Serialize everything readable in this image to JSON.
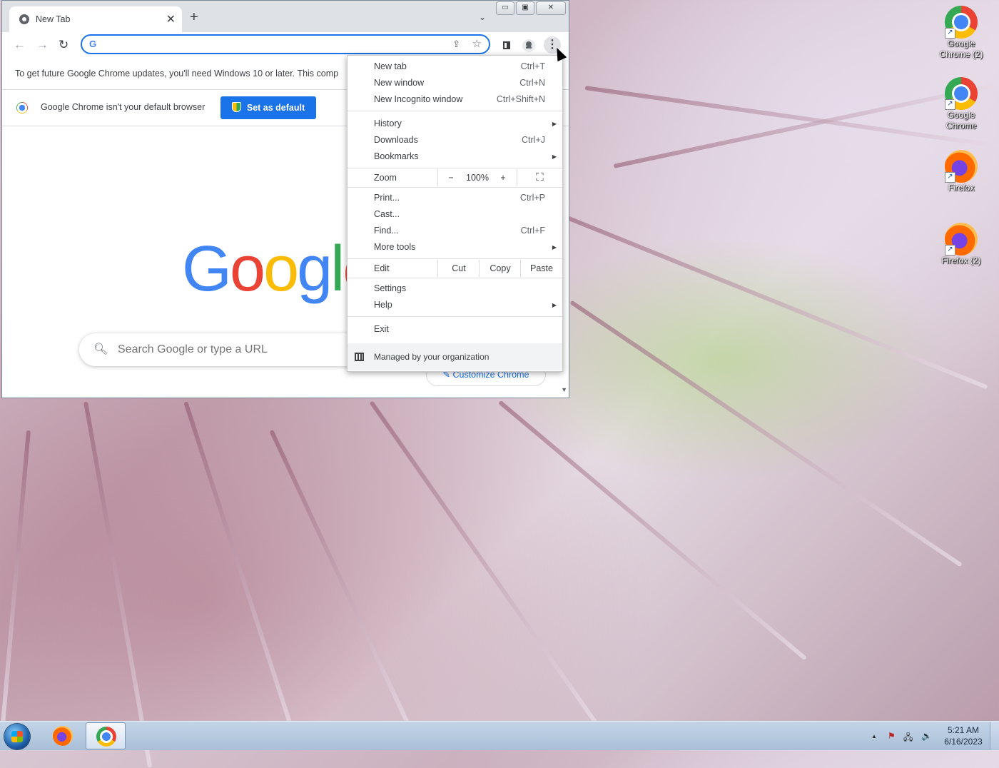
{
  "desktop": {
    "icons": [
      {
        "label_line1": "Google",
        "label_line2": "Chrome (2)",
        "icon": "chrome-icon"
      },
      {
        "label_line1": "Google",
        "label_line2": "Chrome",
        "icon": "chrome-icon"
      },
      {
        "label_line1": "Firefox",
        "label_line2": "",
        "icon": "firefox-icon"
      },
      {
        "label_line1": "Firefox (2)",
        "label_line2": "",
        "icon": "firefox-icon"
      }
    ]
  },
  "browser": {
    "tab": {
      "title": "New Tab",
      "close": "✕"
    },
    "new_tab_symbol": "+",
    "tab_search_symbol": "⌄",
    "window_controls": {
      "minimize": "▭",
      "restore": "▣",
      "close": "✕"
    },
    "toolbar": {
      "back": "←",
      "forward": "→",
      "reload": "↻",
      "omnibox_value": "",
      "omnibox_g": "G",
      "share": "⇪",
      "bookmark": "☆",
      "menu": "⋮"
    },
    "infobar_update": "To get future Google Chrome updates, you'll need Windows 10 or later. This comp",
    "infobar_default": {
      "text": "Google Chrome isn't your default browser",
      "button": "Set as default"
    },
    "ntp": {
      "logo": [
        "G",
        "o",
        "o",
        "g",
        "l",
        "e"
      ],
      "search_placeholder": "Search Google or type a URL",
      "customize": "Customize Chrome",
      "search_icon": "🔍︎",
      "pencil": "✎"
    }
  },
  "menu": {
    "items_top": [
      {
        "label": "New tab",
        "shortcut": "Ctrl+T"
      },
      {
        "label": "New window",
        "shortcut": "Ctrl+N"
      },
      {
        "label": "New Incognito window",
        "shortcut": "Ctrl+Shift+N"
      }
    ],
    "history": {
      "label": "History",
      "arrow": "▶"
    },
    "downloads": {
      "label": "Downloads",
      "shortcut": "Ctrl+J"
    },
    "bookmarks": {
      "label": "Bookmarks",
      "arrow": "▶"
    },
    "zoom": {
      "label": "Zoom",
      "minus": "−",
      "value": "100%",
      "plus": "+",
      "fullscreen": "⛶"
    },
    "print": {
      "label": "Print...",
      "shortcut": "Ctrl+P"
    },
    "cast": {
      "label": "Cast..."
    },
    "find": {
      "label": "Find...",
      "shortcut": "Ctrl+F"
    },
    "more_tools": {
      "label": "More tools",
      "arrow": "▶"
    },
    "edit": {
      "label": "Edit",
      "cut": "Cut",
      "copy": "Copy",
      "paste": "Paste"
    },
    "settings": {
      "label": "Settings"
    },
    "help": {
      "label": "Help",
      "arrow": "▶"
    },
    "exit": {
      "label": "Exit"
    },
    "managed": {
      "label": "Managed by your organization"
    }
  },
  "taskbar": {
    "clock_time": "5:21 AM",
    "clock_date": "6/16/2023",
    "tray_up": "▲",
    "tray_flag": "⚑",
    "tray_network": "🖧",
    "tray_volume": "🔈"
  }
}
